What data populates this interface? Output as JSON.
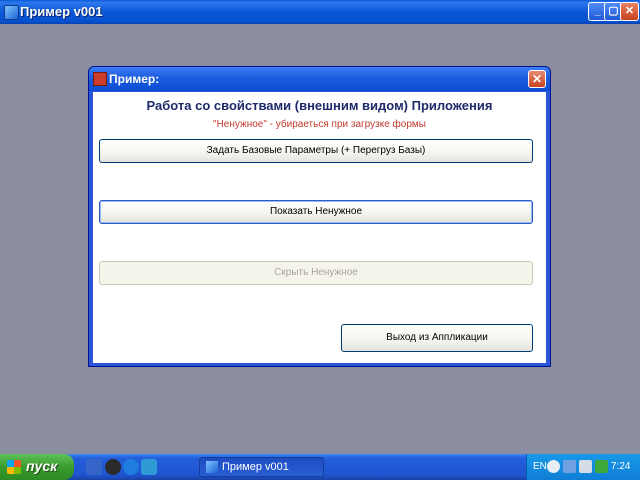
{
  "app": {
    "title": "Пример v001",
    "controls": {
      "minimize": "_",
      "maximize": "▢",
      "close": "✕"
    }
  },
  "dialog": {
    "title": "Пример:",
    "close": "✕",
    "heading": "Работа со свойствами (внешним видом) Приложения",
    "note": "\"Ненужное\" - убираеться при загрузке формы",
    "buttons": {
      "set_base_params": "Задать Базовые Параметры (+ Перегруз Базы)",
      "show_unneeded": "Показать Ненужное",
      "hide_unneeded": "Скрыть Ненужное",
      "exit_app": "Выход из Аппликации"
    },
    "hide_disabled": true
  },
  "taskbar": {
    "start_label": "пуск",
    "task_label": "Пример v001",
    "language": "EN",
    "clock": "7:24",
    "quick_launch_icons": [
      "desktop-icon",
      "media-player-icon",
      "ie-icon",
      "app-icon"
    ]
  }
}
